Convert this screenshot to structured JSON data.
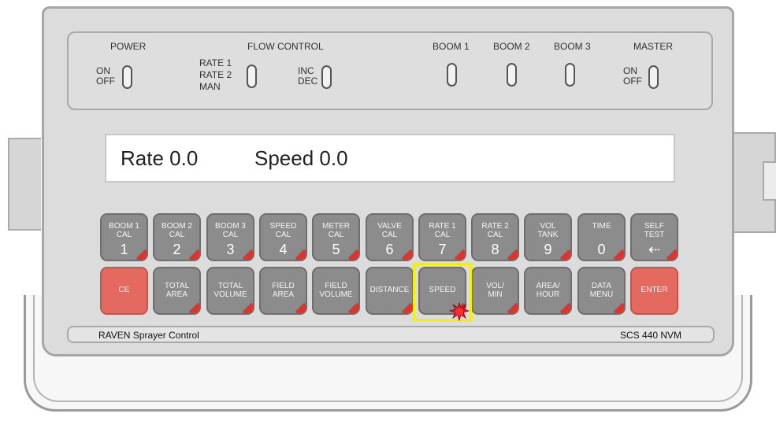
{
  "switch_panel": {
    "power_label": "POWER",
    "power_on": "ON",
    "power_off": "OFF",
    "flow_control_label": "FLOW CONTROL",
    "rate1": "RATE 1",
    "rate2": "RATE 2",
    "man": "MAN",
    "inc": "INC",
    "dec": "DEC",
    "boom1": "BOOM 1",
    "boom2": "BOOM 2",
    "boom3": "BOOM 3",
    "master_label": "MASTER",
    "master_on": "ON",
    "master_off": "OFF"
  },
  "display": {
    "rate_text": "Rate 0.0",
    "speed_text": "Speed 0.0"
  },
  "keys_row1": [
    {
      "label": "BOOM 1\nCAL",
      "number": "1"
    },
    {
      "label": "BOOM 2\nCAL",
      "number": "2"
    },
    {
      "label": "BOOM 3\nCAL",
      "number": "3"
    },
    {
      "label": "SPEED\nCAL",
      "number": "4"
    },
    {
      "label": "METER\nCAL",
      "number": "5"
    },
    {
      "label": "VALVE\nCAL",
      "number": "6"
    },
    {
      "label": "RATE 1\nCAL",
      "number": "7"
    },
    {
      "label": "RATE 2\nCAL",
      "number": "8"
    },
    {
      "label": "VOL\nTANK",
      "number": "9"
    },
    {
      "label": "TIME",
      "number": "0"
    },
    {
      "label": "SELF\nTEST",
      "number": "⇠"
    }
  ],
  "keys_row2": [
    {
      "label": "CE"
    },
    {
      "label": "TOTAL\nAREA"
    },
    {
      "label": "TOTAL\nVOLUME"
    },
    {
      "label": "FIELD\nAREA"
    },
    {
      "label": "FIELD\nVOLUME"
    },
    {
      "label": "DISTANCE"
    },
    {
      "label": "SPEED"
    },
    {
      "label": "VOL/\nMIN"
    },
    {
      "label": "AREA/\nHOUR"
    },
    {
      "label": "DATA\nMENU"
    },
    {
      "label": "ENTER"
    }
  ],
  "footer": {
    "brand": "RAVEN Sprayer Control",
    "model": "SCS 440 NVM"
  },
  "colors": {
    "key_gray": "#8c8c8c",
    "key_red": "#e46a5f",
    "corner_red": "#e0332b",
    "highlight": "#f3f000"
  }
}
